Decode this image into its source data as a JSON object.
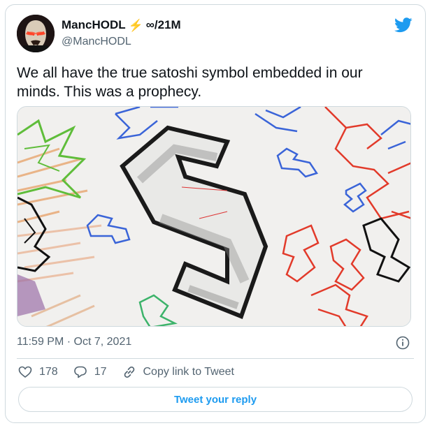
{
  "author": {
    "display_name": "MancHODL",
    "name_emoji_icon": "lightning-bolt-icon",
    "name_emoji": "⚡",
    "name_suffix": "∞/21M",
    "handle": "@MancHODL"
  },
  "tweet": {
    "text": "We all have the true satoshi symbol embedded in our minds. This was a prophecy.",
    "timestamp": "11:59 PM · Oct 7, 2021"
  },
  "actions": {
    "like_count": "178",
    "reply_count": "17",
    "copy_link_label": "Copy link to Tweet"
  },
  "reply_button_label": "Tweet your reply",
  "colors": {
    "accent": "#1d9bf0",
    "text_primary": "#0f1419",
    "text_secondary": "#536471",
    "border": "#cfd9de"
  }
}
